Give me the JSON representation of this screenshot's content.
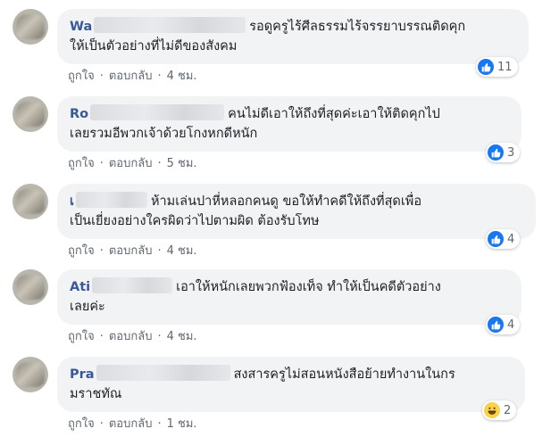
{
  "comments": [
    {
      "name_visible": "Wa",
      "line1": "รอดูครูไร้ศีลธรรมไร้จรรยาบรรณติดคุก",
      "line2": "ให้เป็นตัวอย่างที่ไม่ดีของสังคม",
      "like_label": "ถูกใจ",
      "reply_label": "ตอบกลับ",
      "time": "4 ชม.",
      "reaction_count": "11",
      "reaction_icon": "like-icon"
    },
    {
      "name_visible": "Ro",
      "line1": "คนไม่ดีเอาให้ถึงที่สุดค่ะเอาให้ติดคุกไป",
      "line2": "เลยรวมอีพวกเจ้าด้วยโกงหกดีหนัก",
      "like_label": "ถูกใจ",
      "reply_label": "ตอบกลับ",
      "time": "5 ชม.",
      "reaction_count": "3",
      "reaction_icon": "like-icon"
    },
    {
      "name_visible": "เ",
      "line1": "ห้ามเล่นปาหี่หลอกคนดู ขอให้ทำคดีให้ถึงที่สุดเพื่อ",
      "line2": "เป็นเยี่ยงอย่างใครผิดว่าไปตามผิด ต้องรับโทษ",
      "like_label": "ถูกใจ",
      "reply_label": "ตอบกลับ",
      "time": "4 ชม.",
      "reaction_count": "4",
      "reaction_icon": "like-icon"
    },
    {
      "name_visible": "Ati",
      "line1": "เอาให้หนักเลยพวกฟ้องเท็จ ทำให้เป็นคดีตัวอย่าง",
      "line2": "เลยค่ะ",
      "like_label": "ถูกใจ",
      "reply_label": "ตอบกลับ",
      "time": "4 ชม.",
      "reaction_count": "4",
      "reaction_icon": "like-icon"
    },
    {
      "name_visible": "Pra",
      "line1": "สงสารครูไม่สอนหนังสือย้ายทำงานในกร",
      "line2": "มราชทัณ",
      "like_label": "ถูกใจ",
      "reply_label": "ตอบกลับ",
      "time": "1 ชม.",
      "reaction_count": "2",
      "reaction_icon": "haha-icon"
    }
  ],
  "colors": {
    "name": "#385898",
    "bubble": "#f2f3f5",
    "meta": "#606770",
    "like": "#1877f2",
    "haha": "#f7d24b"
  }
}
